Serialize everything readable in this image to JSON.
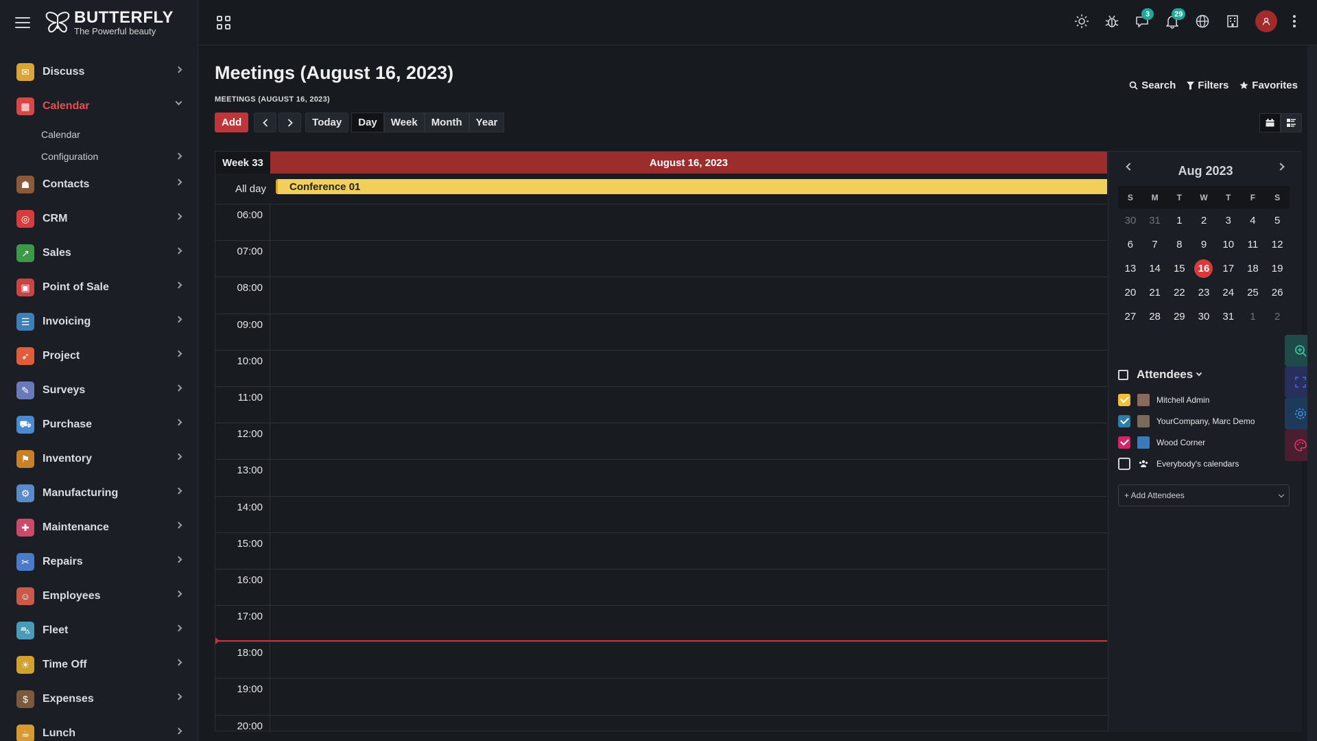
{
  "brand": {
    "title": "BUTTERFLY",
    "subtitle": "The Powerful beauty"
  },
  "sidebar": {
    "items": [
      {
        "label": "Discuss",
        "icon": "discuss-icon",
        "color": "#d9a43a"
      },
      {
        "label": "Calendar",
        "icon": "calendar-icon",
        "color": "#d64848",
        "active": true
      },
      {
        "label": "Contacts",
        "icon": "contacts-icon",
        "color": "#8a5a3a"
      },
      {
        "label": "CRM",
        "icon": "crm-icon",
        "color": "#d63c3c"
      },
      {
        "label": "Sales",
        "icon": "sales-icon",
        "color": "#3a9a4a"
      },
      {
        "label": "Point of Sale",
        "icon": "point-of-sale-icon",
        "color": "#c94545"
      },
      {
        "label": "Invoicing",
        "icon": "invoicing-icon",
        "color": "#3d7fb8"
      },
      {
        "label": "Project",
        "icon": "project-icon",
        "color": "#e05c3a"
      },
      {
        "label": "Surveys",
        "icon": "surveys-icon",
        "color": "#6a7ab8"
      },
      {
        "label": "Purchase",
        "icon": "purchase-icon",
        "color": "#4a8ad0"
      },
      {
        "label": "Inventory",
        "icon": "inventory-icon",
        "color": "#c9802a"
      },
      {
        "label": "Manufacturing",
        "icon": "manufacturing-icon",
        "color": "#5a8ac8"
      },
      {
        "label": "Maintenance",
        "icon": "maintenance-icon",
        "color": "#c94a6a"
      },
      {
        "label": "Repairs",
        "icon": "repairs-icon",
        "color": "#4a7ac8"
      },
      {
        "label": "Employees",
        "icon": "employees-icon",
        "color": "#c95a4a"
      },
      {
        "label": "Fleet",
        "icon": "fleet-icon",
        "color": "#4a9ab8"
      },
      {
        "label": "Time Off",
        "icon": "time-off-icon",
        "color": "#d0a030"
      },
      {
        "label": "Expenses",
        "icon": "expenses-icon",
        "color": "#7a5a3a"
      },
      {
        "label": "Lunch",
        "icon": "lunch-icon",
        "color": "#d89a30"
      }
    ],
    "calendar_sub": {
      "calendar": "Calendar",
      "configuration": "Configuration"
    }
  },
  "topbar": {
    "chat_badge": "3",
    "notif_badge": "29"
  },
  "page": {
    "title": "Meetings (August 16, 2023)",
    "breadcrumb": "MEETINGS (AUGUST 16, 2023)",
    "search": "Search",
    "filters": "Filters",
    "favorites": "Favorites"
  },
  "toolbar": {
    "add": "Add",
    "today": "Today",
    "day": "Day",
    "week": "Week",
    "month": "Month",
    "year": "Year"
  },
  "calendar": {
    "week_label": "Week 33",
    "day_label": "August 16, 2023",
    "allday_label": "All day",
    "event": "Conference 01",
    "event_color": "#f2cf5b",
    "hours": [
      "06:00",
      "07:00",
      "08:00",
      "09:00",
      "10:00",
      "11:00",
      "12:00",
      "13:00",
      "14:00",
      "15:00",
      "16:00",
      "17:00",
      "18:00",
      "19:00",
      "20:00"
    ]
  },
  "mini_calendar": {
    "month_label": "Aug 2023",
    "dow": [
      "S",
      "M",
      "T",
      "W",
      "T",
      "F",
      "S"
    ],
    "weeks": [
      [
        {
          "d": "30",
          "m": true
        },
        {
          "d": "31",
          "m": true
        },
        {
          "d": "1"
        },
        {
          "d": "2"
        },
        {
          "d": "3"
        },
        {
          "d": "4"
        },
        {
          "d": "5"
        }
      ],
      [
        {
          "d": "6"
        },
        {
          "d": "7"
        },
        {
          "d": "8"
        },
        {
          "d": "9"
        },
        {
          "d": "10"
        },
        {
          "d": "11"
        },
        {
          "d": "12"
        }
      ],
      [
        {
          "d": "13"
        },
        {
          "d": "14"
        },
        {
          "d": "15"
        },
        {
          "d": "16",
          "today": true
        },
        {
          "d": "17"
        },
        {
          "d": "18"
        },
        {
          "d": "19"
        }
      ],
      [
        {
          "d": "20"
        },
        {
          "d": "21"
        },
        {
          "d": "22"
        },
        {
          "d": "23"
        },
        {
          "d": "24"
        },
        {
          "d": "25"
        },
        {
          "d": "26"
        }
      ],
      [
        {
          "d": "27"
        },
        {
          "d": "28"
        },
        {
          "d": "29"
        },
        {
          "d": "30"
        },
        {
          "d": "31"
        },
        {
          "d": "1",
          "m": true
        },
        {
          "d": "2",
          "m": true
        }
      ]
    ]
  },
  "attendees": {
    "heading": "Attendees",
    "list": [
      {
        "name": "Mitchell Admin",
        "color": "#f2c037",
        "checked": true,
        "avatar_color": "#8a6a5a"
      },
      {
        "name": "YourCompany, Marc Demo",
        "color": "#2e7da6",
        "checked": true,
        "avatar_color": "#7a6a5a"
      },
      {
        "name": "Wood Corner",
        "color": "#d6246a",
        "checked": true,
        "avatar_color": "#3a7ab8"
      },
      {
        "name": "Everybody's calendars",
        "color": "",
        "checked": false,
        "avatar_color": ""
      }
    ],
    "add_label": "+ Add Attendees"
  },
  "floating": [
    {
      "icon": "zoom-in-icon",
      "bg": "#1e4a4a",
      "fg": "#3ac0a0"
    },
    {
      "icon": "fullscreen-icon",
      "bg": "#26305a",
      "fg": "#4a5ad8"
    },
    {
      "icon": "settings-icon",
      "bg": "#1e3a5a",
      "fg": "#3a8ad8"
    },
    {
      "icon": "palette-icon",
      "bg": "#4a1e2e",
      "fg": "#d83a6a"
    }
  ]
}
